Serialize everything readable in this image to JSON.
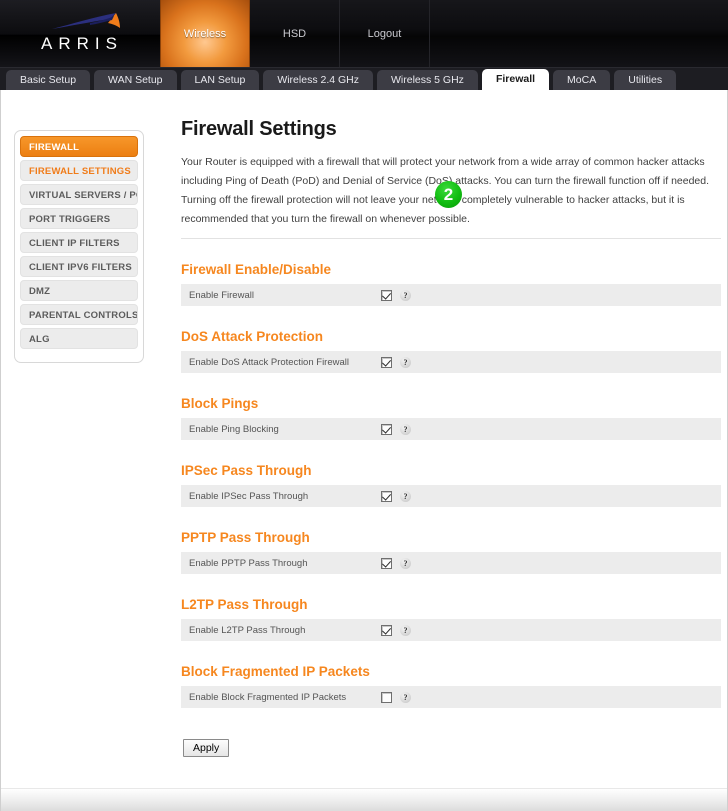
{
  "brand": {
    "wordmark": "ARRIS",
    "logo_icon": "arris-swoosh-logo",
    "swoosh_blue": "#2b2f7e",
    "swoosh_orange": "#f07c1a"
  },
  "topnav": {
    "items": [
      {
        "label": "Wireless",
        "active": true
      },
      {
        "label": "HSD",
        "active": false
      },
      {
        "label": "Logout",
        "active": false
      }
    ]
  },
  "tabs": [
    {
      "label": "Basic Setup",
      "active": false
    },
    {
      "label": "WAN Setup",
      "active": false
    },
    {
      "label": "LAN Setup",
      "active": false
    },
    {
      "label": "Wireless 2.4 GHz",
      "active": false
    },
    {
      "label": "Wireless 5 GHz",
      "active": false
    },
    {
      "label": "Firewall",
      "active": true
    },
    {
      "label": "MoCA",
      "active": false
    },
    {
      "label": "Utilities",
      "active": false
    }
  ],
  "sidebar": {
    "header": "FIREWALL",
    "items": [
      {
        "label": "FIREWALL SETTINGS",
        "active": true
      },
      {
        "label": "VIRTUAL SERVERS / PORT ...",
        "active": false
      },
      {
        "label": "PORT TRIGGERS",
        "active": false
      },
      {
        "label": "CLIENT IP FILTERS",
        "active": false
      },
      {
        "label": "CLIENT IPV6 FILTERS",
        "active": false
      },
      {
        "label": "DMZ",
        "active": false
      },
      {
        "label": "PARENTAL CONTROLS",
        "active": false
      },
      {
        "label": "ALG",
        "active": false
      }
    ]
  },
  "main": {
    "title": "Firewall Settings",
    "intro": "Your Router is equipped with a firewall that will protect your network from a wide array of common hacker attacks including Ping of Death (PoD) and Denial of Service (DoS) attacks. You can turn the firewall function off if needed. Turning off the firewall protection will not leave your network completely vulnerable to hacker attacks, but it is recommended that you turn the firewall on whenever possible.",
    "sections": [
      {
        "title": "Firewall Enable/Disable",
        "row_label": "Enable Firewall",
        "checked": true,
        "help_icon": "question-mark-icon"
      },
      {
        "title": "DoS Attack Protection",
        "row_label": "Enable DoS Attack Protection Firewall",
        "checked": true,
        "help_icon": "question-mark-icon"
      },
      {
        "title": "Block Pings",
        "row_label": "Enable Ping Blocking",
        "checked": true,
        "help_icon": "question-mark-icon"
      },
      {
        "title": "IPSec Pass Through",
        "row_label": "Enable IPSec Pass Through",
        "checked": true,
        "help_icon": "question-mark-icon"
      },
      {
        "title": "PPTP Pass Through",
        "row_label": "Enable PPTP Pass Through",
        "checked": true,
        "help_icon": "question-mark-icon"
      },
      {
        "title": "L2TP Pass Through",
        "row_label": "Enable L2TP Pass Through",
        "checked": true,
        "help_icon": "question-mark-icon"
      },
      {
        "title": "Block Fragmented IP Packets",
        "row_label": "Enable Block Fragmented IP Packets",
        "checked": false,
        "help_icon": "question-mark-icon"
      }
    ],
    "apply_label": "Apply"
  },
  "annotation": {
    "step_number": "2",
    "color": "#0cb80c"
  },
  "theme": {
    "accent_orange": "#f6871f",
    "sidebar_header_orange": "#f08a1c",
    "row_bg": "#ececec",
    "header_bg": "#0b0b0d"
  }
}
